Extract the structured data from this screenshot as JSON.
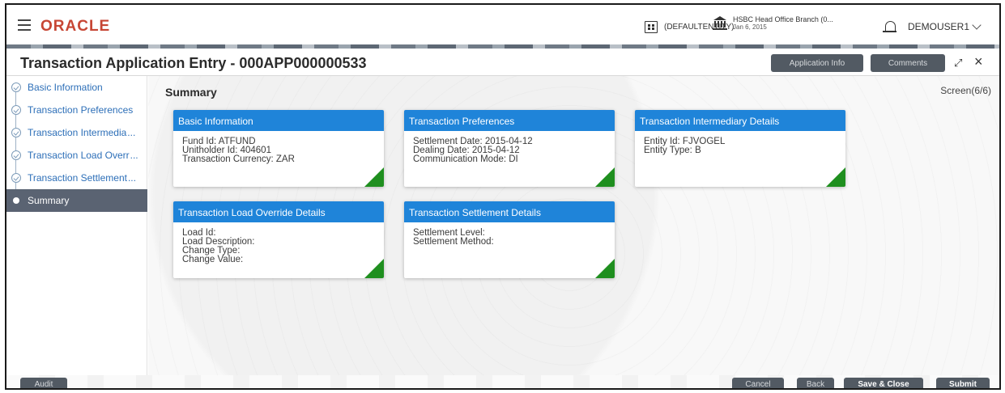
{
  "header": {
    "logo": "ORACLE",
    "entity": "(DEFAULTENTITY)",
    "branch_name": "HSBC Head Office Branch (0...",
    "branch_date": "Jan 6, 2015",
    "user": "DEMOUSER1"
  },
  "titlebar": {
    "title": "Transaction Application Entry - 000APP000000533",
    "application_info": "Application Info",
    "comments": "Comments"
  },
  "sidebar": {
    "steps": [
      {
        "label": "Basic Information",
        "ellipsis": ""
      },
      {
        "label": "Transaction Preferences",
        "ellipsis": ""
      },
      {
        "label": "Transaction Intermedia",
        "ellipsis": "..."
      },
      {
        "label": "Transaction Load Overr",
        "ellipsis": "..."
      },
      {
        "label": "Transaction Settlement",
        "ellipsis": "..."
      },
      {
        "label": "Summary",
        "ellipsis": ""
      }
    ]
  },
  "content": {
    "heading": "Summary",
    "screen": "Screen(6/6)",
    "cards": [
      {
        "title": "Basic Information",
        "lines": [
          "Fund Id: ATFUND",
          "Unitholder Id: 404601",
          "Transaction Currency: ZAR"
        ]
      },
      {
        "title": "Transaction Preferences",
        "lines": [
          "Settlement Date: 2015-04-12",
          "Dealing Date: 2015-04-12",
          "Communication Mode: DI"
        ]
      },
      {
        "title": "Transaction Intermediary Details",
        "lines": [
          "Entity Id: FJVOGEL",
          "Entity Type: B",
          ""
        ]
      },
      {
        "title": "Transaction Load Override Details",
        "lines": [
          "Load Id:",
          "Load Description:",
          "Change Type:",
          "Change Value:"
        ]
      },
      {
        "title": "Transaction Settlement Details",
        "lines": [
          "Settlement Level:",
          "Settlement Method:",
          ""
        ]
      }
    ]
  },
  "footer": {
    "audit": "Audit",
    "cancel": "Cancel",
    "back": "Back",
    "save_close": "Save & Close",
    "submit": "Submit"
  },
  "colors": {
    "oracle_red": "#c74634",
    "card_header_blue": "#1f84d9",
    "card_corner_green": "#1f8f1f",
    "button_dark": "#525a63",
    "active_step": "#5a6372"
  }
}
